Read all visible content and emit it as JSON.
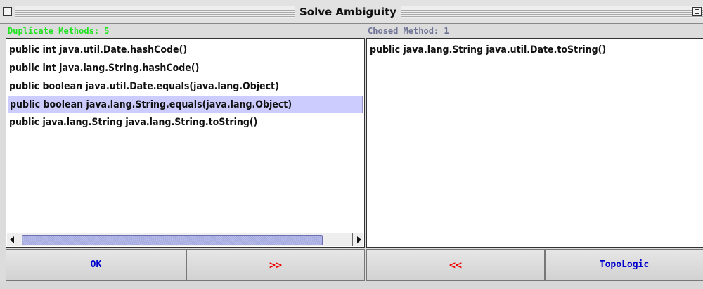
{
  "window": {
    "title": "Solve Ambiguity"
  },
  "left_panel": {
    "header": "Duplicate Methods: 5",
    "header_color": "#1fe31f",
    "items": [
      "public int java.util.Date.hashCode()",
      "public int java.lang.String.hashCode()",
      "public boolean java.util.Date.equals(java.lang.Object)",
      "public boolean java.lang.String.equals(java.lang.Object)",
      "public java.lang.String java.lang.String.toString()"
    ],
    "selected_index": 3,
    "selection_color": "#ccccff"
  },
  "right_panel": {
    "header": "Chosed Method: 1",
    "header_color": "#6f7396",
    "items": [
      "public java.lang.String java.util.Date.toString()"
    ]
  },
  "buttons": {
    "ok": "OK",
    "add": ">>",
    "remove": "<<",
    "topologic": "TopoLogic"
  },
  "colors": {
    "button_text_blue": "#0000cc",
    "button_text_red": "#ee0000"
  }
}
